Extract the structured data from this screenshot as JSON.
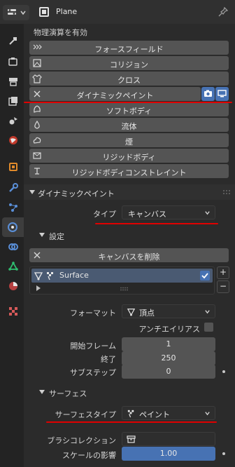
{
  "header": {
    "object_name": "Plane"
  },
  "physics": {
    "title": "物理演算を有効",
    "buttons": [
      {
        "label": "フォースフィールド"
      },
      {
        "label": "コリジョン"
      },
      {
        "label": "クロス"
      },
      {
        "label": "ダイナミックペイント"
      },
      {
        "label": "ソフトボディ"
      },
      {
        "label": "流体"
      },
      {
        "label": "煙"
      },
      {
        "label": "リジッドボディ"
      },
      {
        "label": "リジッドボディコンストレイント"
      }
    ]
  },
  "dynamic_paint": {
    "title": "ダイナミックペイント",
    "type_label": "タイプ",
    "type_value": "キャンバス",
    "settings_title": "設定",
    "remove_canvas_label": "キャンバスを削除",
    "surface_list": [
      {
        "name": "Surface"
      }
    ],
    "format_label": "フォーマット",
    "format_value": "頂点",
    "antialias_label": "アンチエイリアス",
    "start_frame_label": "開始フレーム",
    "start_frame_value": "1",
    "end_label": "終了",
    "end_value": "250",
    "substeps_label": "サブステップ",
    "substeps_value": "0"
  },
  "surface": {
    "title": "サーフェス",
    "surface_type_label": "サーフェスタイプ",
    "surface_type_value": "ペイント",
    "brush_collection_label": "ブラシコレクション",
    "scale_influence_label": "スケールの影響",
    "scale_influence_value": "1.00"
  },
  "colors": {
    "accent": "#4772b3",
    "annotation": "#e00000"
  }
}
